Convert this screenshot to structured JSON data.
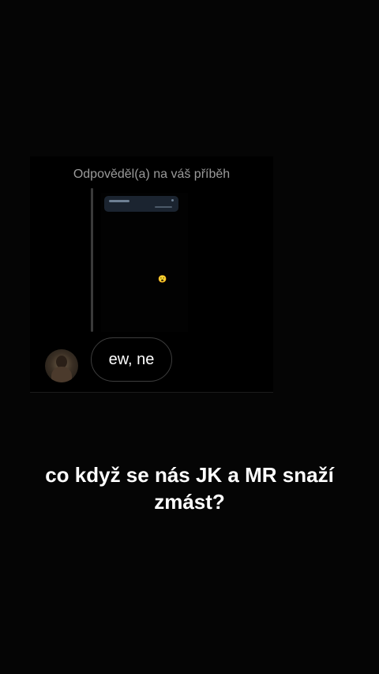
{
  "story_reply": {
    "label": "Odpověděl(a) na váš příběh",
    "emoji": "😮",
    "message": "ew, ne"
  },
  "caption": "co když se nás JK a MR snaží zmást?",
  "icons": [
    "avatar"
  ],
  "colors": {
    "background": "#050505",
    "card": "#000000",
    "label_text": "#9a9a9a",
    "bubble_border": "#3d3d3d"
  }
}
